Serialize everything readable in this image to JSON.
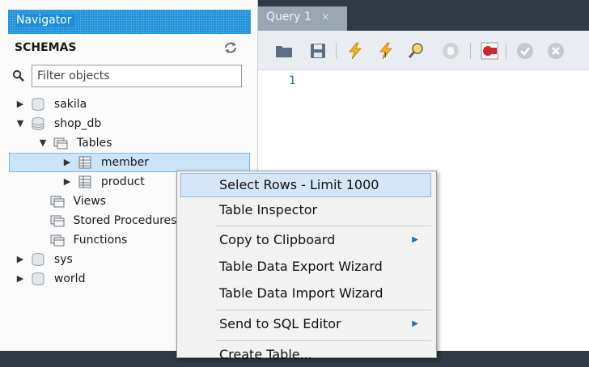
{
  "navigator": {
    "title": "Navigator",
    "schemas_label": "SCHEMAS",
    "filter_placeholder": "Filter objects",
    "tree": {
      "sakila": "sakila",
      "shop_db": "shop_db",
      "tables": "Tables",
      "member": "member",
      "product": "product",
      "views": "Views",
      "stored_procedures": "Stored Procedures",
      "functions": "Functions",
      "sys": "sys",
      "world": "world"
    }
  },
  "editor": {
    "tab_label": "Query 1",
    "tab_close": "×",
    "line_number": "1",
    "toolbar_icons": [
      "open-folder-icon",
      "save-icon",
      "execute-icon",
      "execute-current-icon",
      "explain-icon",
      "stop-icon",
      "toggle-error-icon",
      "commit-icon",
      "rollback-icon"
    ]
  },
  "context_menu": {
    "items": [
      {
        "label": "Select Rows - Limit 1000"
      },
      {
        "label": "Table Inspector"
      },
      {
        "label": "Copy to Clipboard"
      },
      {
        "label": "Table Data Export Wizard"
      },
      {
        "label": "Table Data Import Wizard"
      },
      {
        "label": "Send to SQL Editor"
      },
      {
        "label": "Create Table..."
      }
    ],
    "submenu_arrow": "▶"
  },
  "colors": {
    "navigator_title_bg": "#1b8fd8",
    "selection_bg": "#cce4f7",
    "menu_highlight": "#d5e6f6",
    "tab_strip_bg": "#2f3a45"
  }
}
